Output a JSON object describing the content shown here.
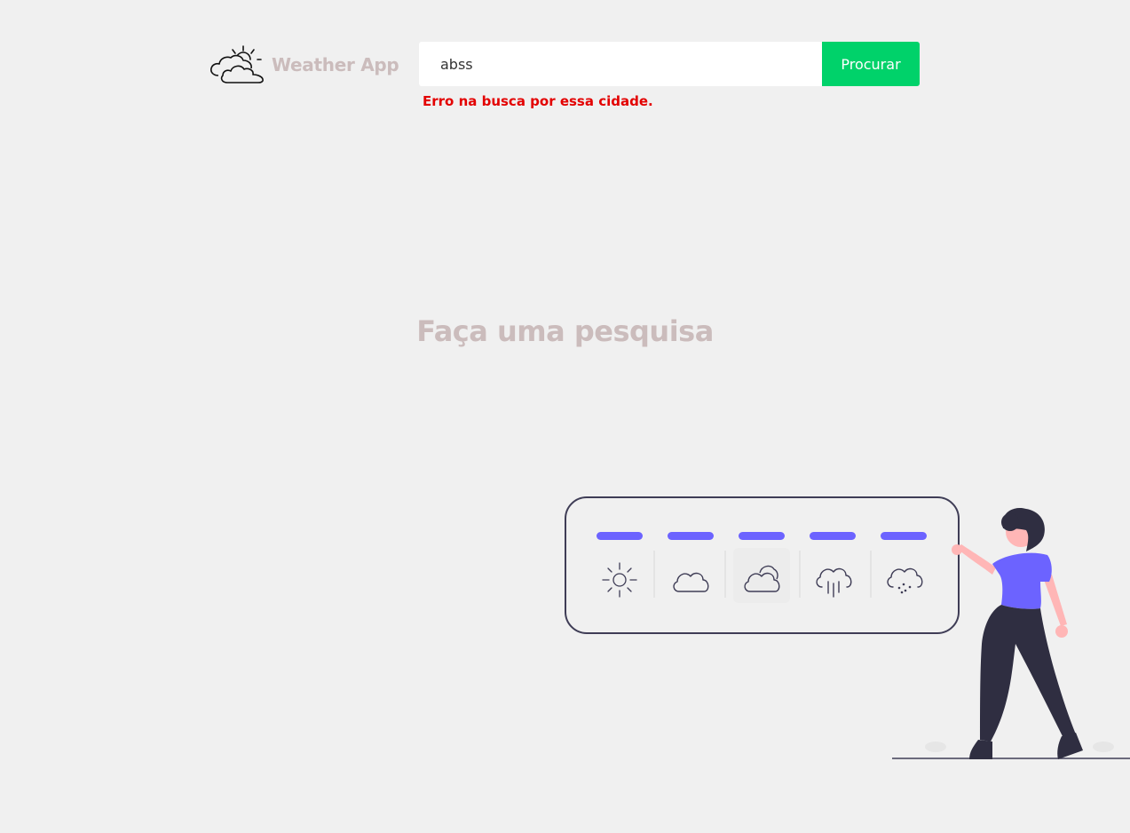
{
  "header": {
    "brand_icon": "partly-cloudy-icon",
    "app_title": "Weather App"
  },
  "search": {
    "value": "abss",
    "placeholder": "",
    "button_label": "Procurar",
    "error_message": "Erro na busca por essa cidade."
  },
  "main": {
    "empty_state_title": "Faça uma pesquisa"
  },
  "illustration": {
    "weather_icons": [
      "sun-icon",
      "cloud-icon",
      "partly-cloudy-icon",
      "rain-icon",
      "snow-icon"
    ]
  },
  "colors": {
    "background": "#f0f0f0",
    "title_muted": "#cbbcbc",
    "button_green": "#00d26a",
    "error_red": "#e30000",
    "accent_purple": "#6c63ff",
    "dark_navy": "#3f3d56"
  }
}
